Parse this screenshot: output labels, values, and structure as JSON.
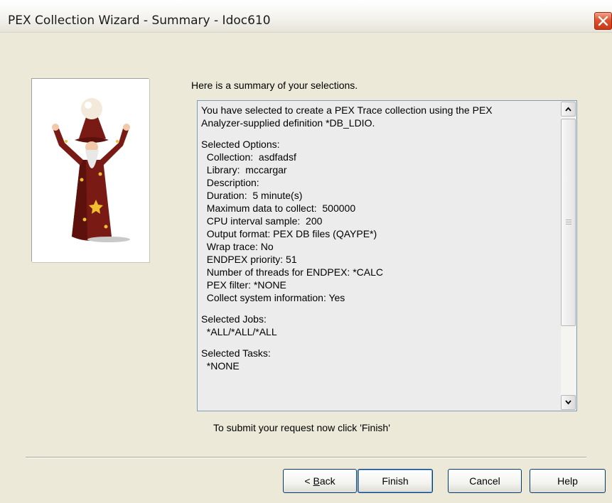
{
  "window": {
    "title": "PEX Collection Wizard - Summary - Idoc610"
  },
  "wizard_image": {
    "icon": "wizard-figure"
  },
  "intro_text": "Here is a summary of your selections.",
  "summary": {
    "lines": [
      "You have selected to create a PEX Trace collection using the PEX",
      "Analyzer-supplied definition *DB_LDIO.",
      "",
      "Selected Options:",
      "  Collection:  asdfadsf",
      "  Library:  mccargar",
      "  Description:",
      "  Duration:  5 minute(s)",
      "  Maximum data to collect:  500000",
      "  CPU interval sample:  200",
      "  Output format: PEX DB files (QAYPE*)",
      "  Wrap trace: No",
      "  ENDPEX priority: 51",
      "  Number of threads for ENDPEX: *CALC",
      "  PEX filter: *NONE",
      "  Collect system information: Yes",
      "",
      "Selected Jobs:",
      "  *ALL/*ALL/*ALL",
      "",
      "Selected Tasks:",
      "  *NONE"
    ]
  },
  "submit_hint": "To submit your request now click 'Finish'",
  "buttons": {
    "back_prefix": "< ",
    "back_mnemonic": "B",
    "back_rest": "ack",
    "finish": "Finish",
    "cancel": "Cancel",
    "help": "Help"
  },
  "colors": {
    "dialog_bg": "#ece9d8",
    "close_button": "#e0522f",
    "button_border": "#003c74"
  }
}
